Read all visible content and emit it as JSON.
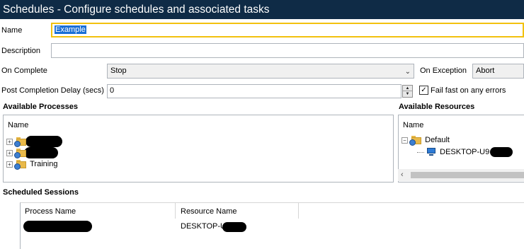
{
  "window": {
    "title": "Schedules - Configure schedules and associated tasks"
  },
  "form": {
    "name_label": "Name",
    "name_value": "Example",
    "description_label": "Description",
    "description_value": "",
    "on_complete_label": "On Complete",
    "on_complete_value": "Stop",
    "on_exception_label": "On Exception",
    "on_exception_value": "Abort",
    "delay_label": "Post Completion Delay (secs)",
    "delay_value": "0",
    "fail_fast_label": "Fail fast on any errors",
    "fail_fast_checked": true
  },
  "processes": {
    "heading": "Available Processes",
    "column": "Name",
    "items": [
      {
        "label": "",
        "redacted": true
      },
      {
        "label": "",
        "redacted": true
      },
      {
        "label": "Training",
        "redacted": false
      }
    ]
  },
  "resources": {
    "heading": "Available Resources",
    "column": "Name",
    "group": "Default",
    "machine": "DESKTOP-U9"
  },
  "sessions": {
    "heading": "Scheduled Sessions",
    "columns": [
      "Process Name",
      "Resource Name"
    ],
    "rows": [
      {
        "process": "",
        "resource": "DESKTOP-U9"
      }
    ]
  },
  "icons": {
    "expand": "plus-square-icon",
    "collapse": "minus-square-icon",
    "folder": "folder-globe-icon",
    "computer": "computer-icon",
    "dropdown": "chevron-down-icon",
    "check": "checkmark-icon"
  },
  "colors": {
    "titlebar": "#0f2b46",
    "focus_border": "#f2c10f",
    "selection": "#1a6fd6"
  }
}
